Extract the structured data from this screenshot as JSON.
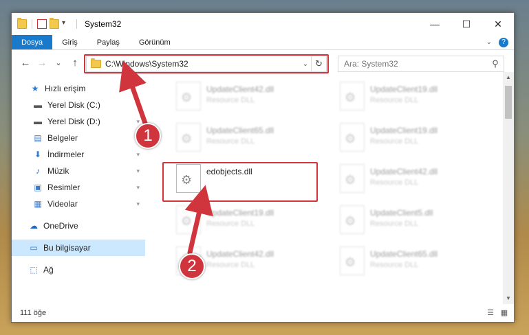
{
  "window": {
    "title": "System32",
    "controls": [
      "—",
      "☐",
      "✕"
    ]
  },
  "ribbon": {
    "tabs": [
      "Dosya",
      "Giriş",
      "Paylaş",
      "Görünüm"
    ],
    "help_caret": "⌄",
    "help_label": "?"
  },
  "navbar": {
    "back": "←",
    "forward": "→",
    "recent": "⌄",
    "up": "↑",
    "address": "C:\\Windows\\System32",
    "search_placeholder": "Ara: System32"
  },
  "sidebar": {
    "items": [
      {
        "label": "Hızlı erişim",
        "icon": "star-icon",
        "glyph": "★",
        "color": "#2e7bd6",
        "pinned": false
      },
      {
        "label": "Yerel Disk (C:)",
        "icon": "drive-icon",
        "glyph": "▬",
        "color": "#555555",
        "pinned": true
      },
      {
        "label": "Yerel Disk (D:)",
        "icon": "drive-icon",
        "glyph": "▬",
        "color": "#555555",
        "pinned": true
      },
      {
        "label": "Belgeler",
        "icon": "document-icon",
        "glyph": "▤",
        "color": "#3d7cc9",
        "pinned": true
      },
      {
        "label": "İndirmeler",
        "icon": "download-icon",
        "glyph": "⬇",
        "color": "#2e7bd6",
        "pinned": true
      },
      {
        "label": "Müzik",
        "icon": "music-icon",
        "glyph": "♪",
        "color": "#2e7bd6",
        "pinned": true
      },
      {
        "label": "Resimler",
        "icon": "pictures-icon",
        "glyph": "▣",
        "color": "#3d7cc9",
        "pinned": true
      },
      {
        "label": "Videolar",
        "icon": "video-icon",
        "glyph": "▦",
        "color": "#3d7cc9",
        "pinned": true
      },
      {
        "label": "OneDrive",
        "icon": "cloud-icon",
        "glyph": "☁",
        "color": "#1a68c9",
        "pinned": false
      },
      {
        "label": "Bu bilgisayar",
        "icon": "computer-icon",
        "glyph": "▭",
        "color": "#2e7bd6",
        "pinned": false
      },
      {
        "label": "Ağ",
        "icon": "network-icon",
        "glyph": "⬚",
        "color": "#2e7bd6",
        "pinned": false
      }
    ],
    "pin_glyph": "📌"
  },
  "files": [
    {
      "name": "UpdateClient42.dll",
      "type": "Resource DLL",
      "blurred": true
    },
    {
      "name": "UpdateClient19.dll",
      "type": "Resource DLL",
      "blurred": true
    },
    {
      "name": "UpdateClient65.dll",
      "type": "Resource DLL",
      "blurred": true
    },
    {
      "name": "UpdateClient19.dll",
      "type": "Resource DLL",
      "blurred": true
    },
    {
      "name": "edobjects.dll",
      "type": "",
      "blurred": false
    },
    {
      "name": "UpdateClient42.dll",
      "type": "Resource DLL",
      "blurred": true
    },
    {
      "name": "UpdateClient19.dll",
      "type": "Resource DLL",
      "blurred": true
    },
    {
      "name": "UpdateClient5.dll",
      "type": "Resource DLL",
      "blurred": true
    },
    {
      "name": "UpdateClient42.dll",
      "type": "Resource DLL",
      "blurred": true
    },
    {
      "name": "UpdateClient65.dll",
      "type": "Resource DLL",
      "blurred": true
    }
  ],
  "status": {
    "count": "111 öğe"
  },
  "annotations": {
    "callout1": "1",
    "callout2": "2",
    "color": "#d0353e"
  }
}
